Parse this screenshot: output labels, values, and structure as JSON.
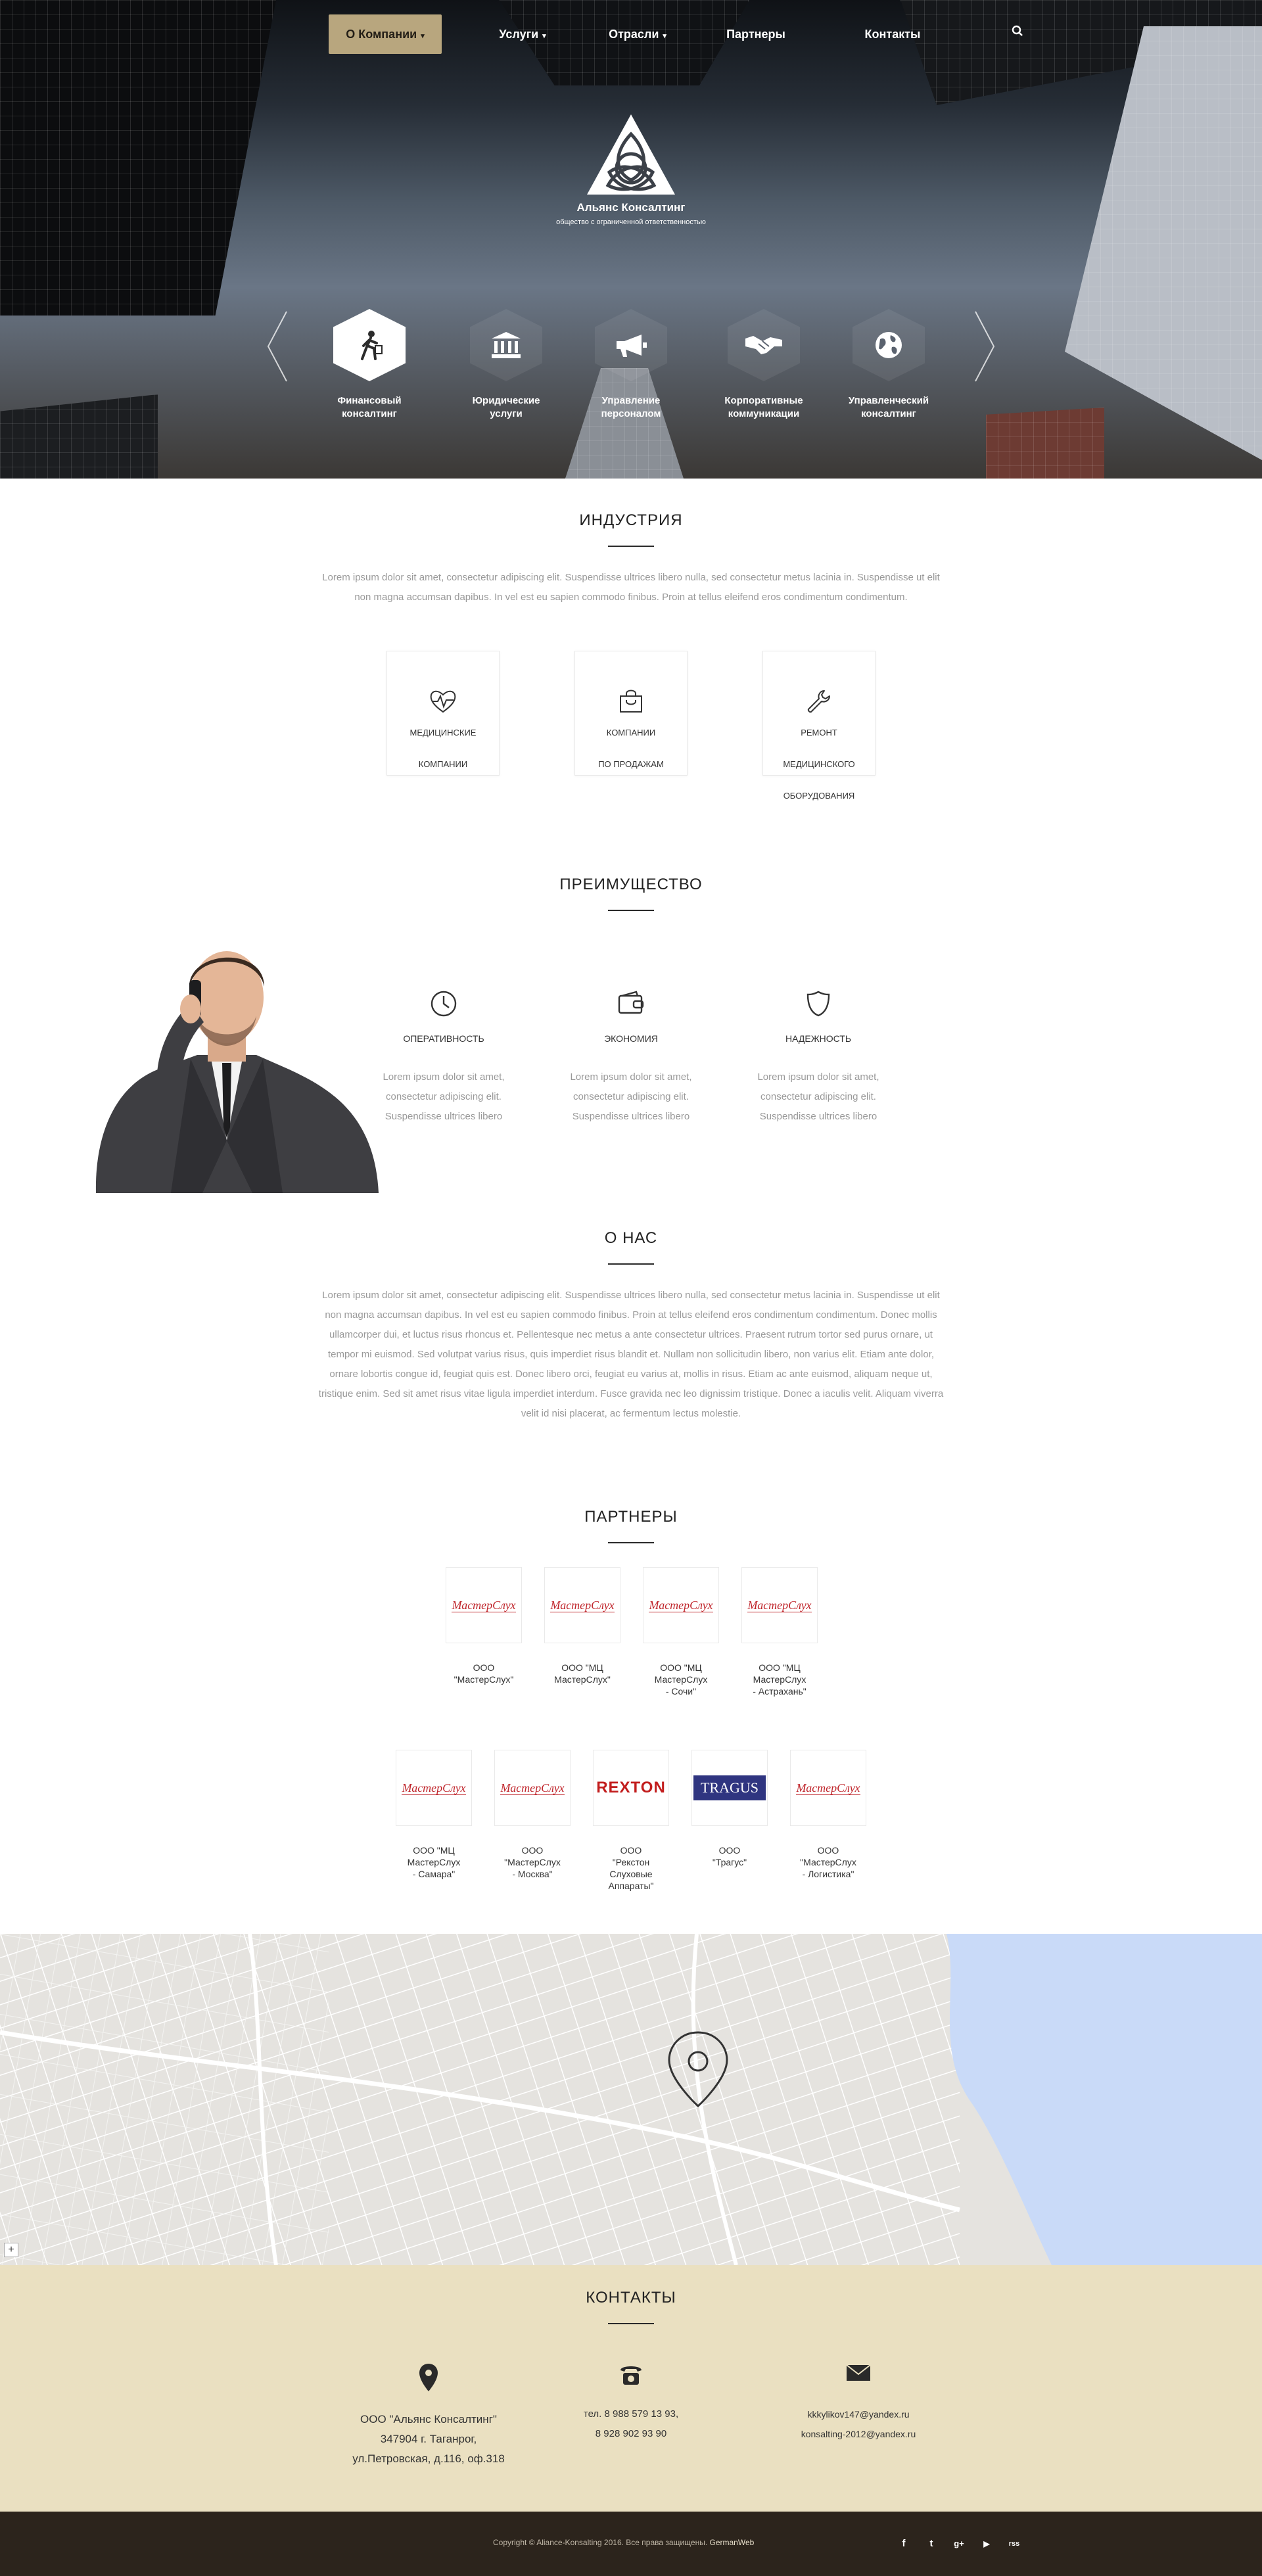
{
  "nav": {
    "items": [
      {
        "label": "О Компании",
        "dropdown": true,
        "active": true
      },
      {
        "label": "Услуги",
        "dropdown": true
      },
      {
        "label": "Отрасли",
        "dropdown": true
      },
      {
        "label": "Партнеры",
        "dropdown": false
      },
      {
        "label": "Контакты",
        "dropdown": false
      }
    ],
    "search_icon": "search-icon",
    "caret": "▾"
  },
  "logo": {
    "name": "Альянс Консалтинг",
    "subtitle": "общество с ограниченной ответственностью"
  },
  "services": [
    {
      "line1": "Финансовый",
      "line2": "консалтинг",
      "icon": "person-walking-icon",
      "active": true
    },
    {
      "line1": "Юридические",
      "line2": "услуги",
      "icon": "court-building-icon"
    },
    {
      "line1": "Управление",
      "line2": "персоналом",
      "icon": "megaphone-icon"
    },
    {
      "line1": "Корпоративные",
      "line2": "коммуникации",
      "icon": "handshake-icon"
    },
    {
      "line1": "Управленческий",
      "line2": "консалтинг",
      "icon": "globe-icon"
    }
  ],
  "industry": {
    "title": "ИНДУСТРИЯ",
    "text": "Lorem ipsum dolor sit amet, consectetur adipiscing elit. Suspendisse ultrices libero nulla, sed consectetur metus lacinia in. Suspendisse ut elit non magna accumsan dapibus. In vel est eu sapien commodo finibus. Proin at tellus eleifend eros condimentum condimentum.",
    "cards": [
      {
        "line1": "МЕДИЦИНСКИЕ",
        "line2": "КОМПАНИИ",
        "line3": "",
        "icon": "heartbeat-icon"
      },
      {
        "line1": "КОМПАНИИ",
        "line2": "ПО ПРОДАЖАМ",
        "line3": "",
        "icon": "shopping-bag-icon"
      },
      {
        "line1": "РЕМОНТ",
        "line2": "МЕДИЦИНСКОГО",
        "line3": "ОБОРУДОВАНИЯ",
        "icon": "wrench-icon"
      }
    ]
  },
  "advantage": {
    "title": "ПРЕИМУЩЕСТВО",
    "items": [
      {
        "label": "ОПЕРАТИВНОСТЬ",
        "icon": "clock-icon",
        "l1": "Lorem ipsum dolor sit amet,",
        "l2": "consectetur adipiscing elit.",
        "l3": "Suspendisse ultrices libero"
      },
      {
        "label": "ЭКОНОМИЯ",
        "icon": "wallet-icon",
        "l1": "Lorem ipsum dolor sit amet,",
        "l2": "consectetur adipiscing elit.",
        "l3": "Suspendisse ultrices libero"
      },
      {
        "label": "НАДЕЖНОСТЬ",
        "icon": "shield-icon",
        "l1": "Lorem ipsum dolor sit amet,",
        "l2": "consectetur adipiscing elit.",
        "l3": "Suspendisse ultrices libero"
      }
    ]
  },
  "about": {
    "title": "О НАС",
    "text": "Lorem ipsum dolor sit amet, consectetur adipiscing elit. Suspendisse ultrices libero nulla, sed consectetur metus lacinia in. Suspendisse ut elit non magna accumsan dapibus. In vel est eu sapien commodo finibus. Proin at tellus eleifend eros condimentum condimentum. Donec mollis ullamcorper dui, et luctus risus rhoncus et. Pellentesque nec metus a ante consectetur ultrices. Praesent rutrum tortor sed purus ornare, ut tempor mi euismod. Sed volutpat varius risus, quis imperdiet risus blandit et. Nullam non sollicitudin libero, non varius elit. Etiam ante dolor, ornare lobortis congue id, feugiat quis est. Donec libero orci, feugiat eu varius at, mollis in risus. Etiam ac ante euismod, aliquam neque ut, tristique enim. Sed sit amet risus vitae ligula imperdiet interdum. Fusce gravida nec leo dignissim tristique. Donec a iaculis velit. Aliquam viverra velit id nisi placerat, ac fermentum lectus molestie."
  },
  "partners": {
    "title": "ПАРТНЕРЫ",
    "row1": [
      {
        "l1": "ООО",
        "l2": "\"МастерСлух\"",
        "l3": "",
        "l4": "",
        "logo": "МастерСлух"
      },
      {
        "l1": "ООО \"МЦ",
        "l2": "МастерСлух\"",
        "l3": "",
        "l4": "",
        "logo": "МастерСлух"
      },
      {
        "l1": "ООО \"МЦ",
        "l2": "МастерСлух",
        "l3": "- Сочи\"",
        "l4": "",
        "logo": "МастерСлух"
      },
      {
        "l1": "ООО \"МЦ",
        "l2": "МастерСлух",
        "l3": "- Астрахань\"",
        "l4": "",
        "logo": "МастерСлух"
      }
    ],
    "row2": [
      {
        "l1": "ООО \"МЦ",
        "l2": "МастерСлух",
        "l3": "- Самара\"",
        "l4": "",
        "logo": "МастерСлух"
      },
      {
        "l1": "ООО",
        "l2": "\"МастерСлух",
        "l3": "- Москва\"",
        "l4": "",
        "logo": "МастерСлух"
      },
      {
        "l1": "ООО",
        "l2": "\"Рекстон",
        "l3": "Слуховые",
        "l4": "Аппараты\"",
        "logo": "REXTON"
      },
      {
        "l1": "ООО",
        "l2": "\"Трагус\"",
        "l3": "",
        "l4": "",
        "logo": "TRAGUS"
      },
      {
        "l1": "ООО",
        "l2": "\"МастерСлух",
        "l3": "- Логистика\"",
        "l4": "",
        "logo": "МастерСлух"
      }
    ]
  },
  "map": {
    "zoom_label": "+",
    "pin_icon": "map-pin-icon"
  },
  "contacts": {
    "title": "КОНТАКТЫ",
    "address": {
      "l1": "ООО \"Альянс Консалтинг\"",
      "l2": "347904 г. Таганрог,",
      "l3": "ул.Петровская, д.116, оф.318",
      "icon": "location-pin-icon"
    },
    "phone": {
      "l1": "тел. 8 988 579 13 93,",
      "l2": "8 928 902 93 90",
      "icon": "telephone-icon"
    },
    "email": {
      "l1": "kkkylikov147@yandex.ru",
      "l2": "konsalting-2012@yandex.ru",
      "icon": "envelope-icon"
    }
  },
  "footer": {
    "copyright": "Copyright © Aliance-Konsalting 2016. Все права защищены.",
    "credit": "GermanWeb",
    "social": [
      {
        "glyph": "f",
        "icon": "facebook-icon"
      },
      {
        "glyph": "t",
        "icon": "twitter-icon"
      },
      {
        "glyph": "g+",
        "icon": "google-plus-icon"
      },
      {
        "glyph": "▶",
        "icon": "youtube-icon"
      },
      {
        "glyph": "rss",
        "icon": "rss-icon"
      }
    ]
  },
  "colors": {
    "accent_gold": "#b8a67e",
    "contacts_bg": "#eae0c1",
    "footer_bg": "#2c241c",
    "map_water": "#c9daf8",
    "brand_red": "#c0272d",
    "tragus_blue": "#2f3580"
  }
}
